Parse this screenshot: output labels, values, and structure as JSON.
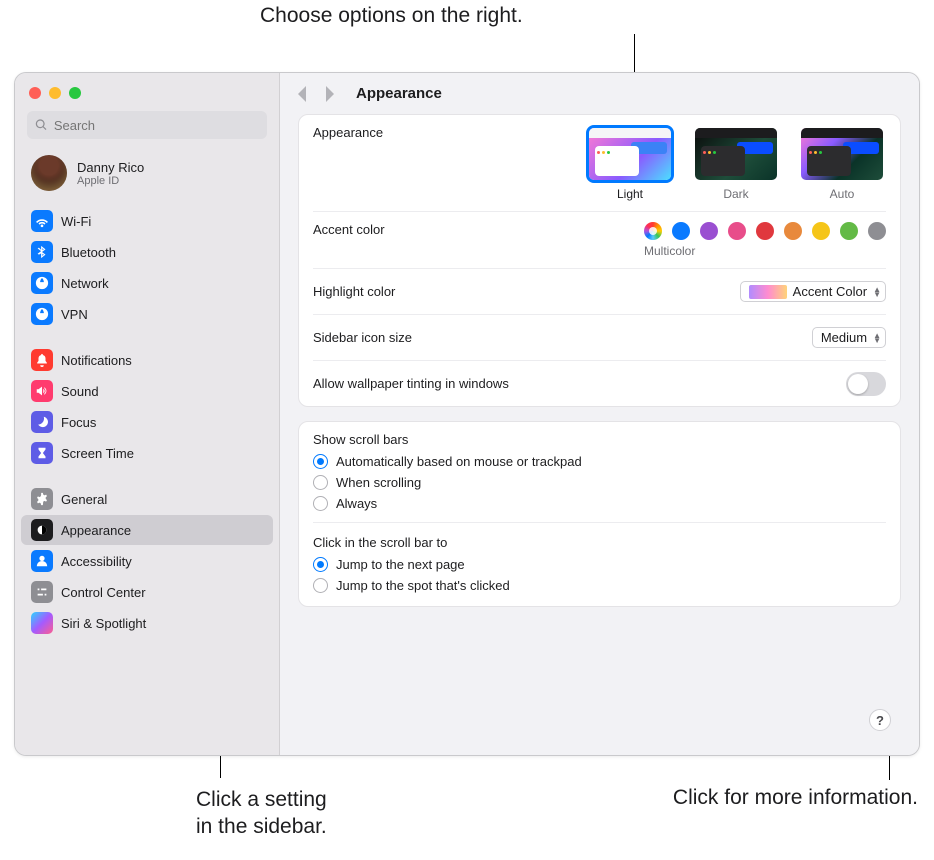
{
  "callouts": {
    "top": "Choose options on the right.",
    "bottomLeft": "Click a setting\nin the sidebar.",
    "bottomRight": "Click for more information."
  },
  "header": {
    "title": "Appearance",
    "search_placeholder": "Search"
  },
  "user": {
    "name": "Danny Rico",
    "sub": "Apple ID"
  },
  "sidebar": {
    "groups": [
      {
        "items": [
          {
            "id": "wifi",
            "label": "Wi-Fi",
            "bg": "#0a7aff",
            "icon": "wifi"
          },
          {
            "id": "bluetooth",
            "label": "Bluetooth",
            "bg": "#0a7aff",
            "icon": "bt"
          },
          {
            "id": "network",
            "label": "Network",
            "bg": "#0a7aff",
            "icon": "globe"
          },
          {
            "id": "vpn",
            "label": "VPN",
            "bg": "#0a7aff",
            "icon": "globe"
          }
        ]
      },
      {
        "items": [
          {
            "id": "notifications",
            "label": "Notifications",
            "bg": "#ff3b30",
            "icon": "bell"
          },
          {
            "id": "sound",
            "label": "Sound",
            "bg": "#ff3b6e",
            "icon": "sound"
          },
          {
            "id": "focus",
            "label": "Focus",
            "bg": "#5e5ce6",
            "icon": "moon"
          },
          {
            "id": "screentime",
            "label": "Screen Time",
            "bg": "#5e5ce6",
            "icon": "hourglass"
          }
        ]
      },
      {
        "items": [
          {
            "id": "general",
            "label": "General",
            "bg": "#8e8e93",
            "icon": "gear"
          },
          {
            "id": "appearance",
            "label": "Appearance",
            "bg": "#1c1c1e",
            "icon": "appearance",
            "selected": true
          },
          {
            "id": "accessibility",
            "label": "Accessibility",
            "bg": "#0a7aff",
            "icon": "person"
          },
          {
            "id": "controlcenter",
            "label": "Control Center",
            "bg": "#8e8e93",
            "icon": "sliders"
          },
          {
            "id": "siri",
            "label": "Siri & Spotlight",
            "bg": "grad",
            "icon": "siri"
          }
        ]
      }
    ]
  },
  "appearance": {
    "label": "Appearance",
    "modes": [
      {
        "key": "light",
        "label": "Light",
        "selected": true
      },
      {
        "key": "dark",
        "label": "Dark",
        "selected": false
      },
      {
        "key": "auto",
        "label": "Auto",
        "selected": false
      }
    ]
  },
  "accent": {
    "label": "Accent color",
    "sub": "Multicolor",
    "colors": [
      {
        "key": "multicolor",
        "css": "multicolor",
        "selected": true
      },
      {
        "key": "blue",
        "hex": "#0a7aff"
      },
      {
        "key": "purple",
        "hex": "#9a4fd1"
      },
      {
        "key": "pink",
        "hex": "#e84d8a"
      },
      {
        "key": "red",
        "hex": "#e0383e"
      },
      {
        "key": "orange",
        "hex": "#e8893c"
      },
      {
        "key": "yellow",
        "hex": "#f5c518"
      },
      {
        "key": "green",
        "hex": "#63ba46"
      },
      {
        "key": "graphite",
        "hex": "#8e8e93"
      }
    ]
  },
  "highlight": {
    "label": "Highlight color",
    "value": "Accent Color"
  },
  "sidebarIcon": {
    "label": "Sidebar icon size",
    "value": "Medium"
  },
  "wallpaperTint": {
    "label": "Allow wallpaper tinting in windows",
    "on": false
  },
  "scrollbars": {
    "label": "Show scroll bars",
    "options": [
      {
        "label": "Automatically based on mouse or trackpad",
        "checked": true
      },
      {
        "label": "When scrolling",
        "checked": false
      },
      {
        "label": "Always",
        "checked": false
      }
    ]
  },
  "clickScroll": {
    "label": "Click in the scroll bar to",
    "options": [
      {
        "label": "Jump to the next page",
        "checked": true
      },
      {
        "label": "Jump to the spot that's clicked",
        "checked": false
      }
    ]
  },
  "help": "?"
}
